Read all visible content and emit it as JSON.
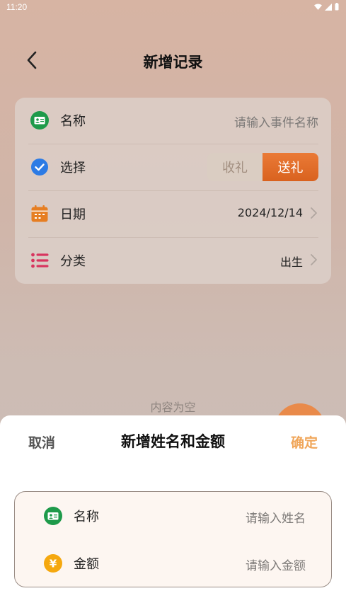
{
  "status": {
    "time": "11:20"
  },
  "nav": {
    "title": "新增记录"
  },
  "form": {
    "name": {
      "label": "名称",
      "placeholder": "请输入事件名称"
    },
    "select": {
      "label": "选择",
      "options": [
        "收礼",
        "送礼"
      ],
      "selected": "送礼"
    },
    "date": {
      "label": "日期",
      "value": "2024/12/14"
    },
    "category": {
      "label": "分类",
      "value": "出生"
    }
  },
  "empty": {
    "text": "内容为空"
  },
  "sheet": {
    "cancel": "取消",
    "title": "新增姓名和金额",
    "confirm": "确定",
    "name": {
      "label": "名称",
      "placeholder": "请输入姓名"
    },
    "amount": {
      "label": "金额",
      "placeholder": "请输入金额",
      "icon_glyph": "¥"
    }
  },
  "colors": {
    "accent": "#e26c28",
    "confirm": "#f0a65a",
    "check": "#2c7be5",
    "id_card_green": "#1e9a4a",
    "calendar_orange": "#e67e22",
    "list_pink": "#d8355f",
    "yen_yellow": "#f5a80f"
  },
  "icons": {
    "back": "chevron-left-icon",
    "name": "id-card-icon",
    "select": "check-circle-icon",
    "date": "calendar-icon",
    "category": "list-icon",
    "amount": "yen-icon"
  }
}
